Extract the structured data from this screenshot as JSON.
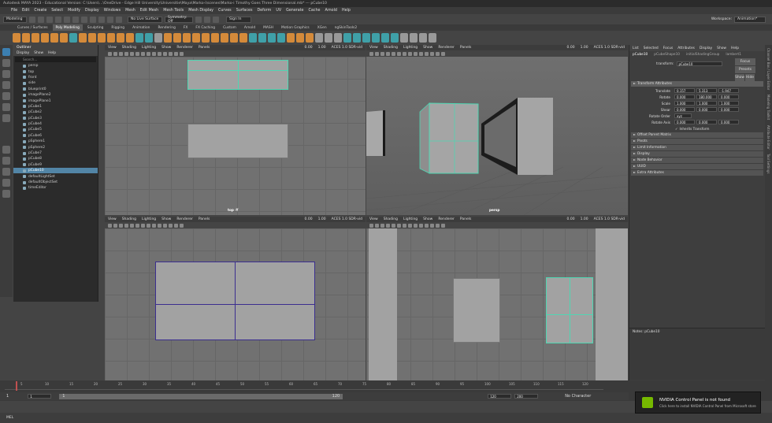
{
  "title_bar": "Autodesk MAYA 2023 - Educational Version: C:\\Users\\...\\OneDrive - Edge Hill University\\Universitie\\Maya\\Marko-i\\scenes\\Marko-i Timothy Goes Three Dimensional.mb*  ---  pCube10",
  "menus": [
    "File",
    "Edit",
    "Create",
    "Select",
    "Modify",
    "Display",
    "Windows",
    "Mesh",
    "Edit Mesh",
    "Mesh Tools",
    "Mesh Display",
    "Curves",
    "Surfaces",
    "Deform",
    "UV",
    "Generate",
    "Cache",
    "Arnold",
    "Help"
  ],
  "workspace": {
    "label": "Workspace:",
    "value": "Animation*"
  },
  "status": {
    "menuset": "Modeling",
    "live_surface": "No Live Surface",
    "symmetry": "Symmetry: Off",
    "sign_in": "Sign In"
  },
  "shelf_tabs": [
    "Curves / Surfaces",
    "Poly Modeling",
    "Sculpting",
    "Rigging",
    "Animation",
    "Rendering",
    "FX",
    "FX Caching",
    "Custom",
    "Arnold",
    "MASH",
    "Motion Graphics",
    "XGen",
    "ngSkinTools2"
  ],
  "shelf_active": "Poly Modeling",
  "outliner": {
    "title": "Outliner",
    "menu": [
      "Display",
      "Show",
      "Help"
    ],
    "search": "Search...",
    "items": [
      {
        "label": "persp"
      },
      {
        "label": "top"
      },
      {
        "label": "front"
      },
      {
        "label": "side"
      },
      {
        "label": "blueprint0"
      },
      {
        "label": "imagePlane2"
      },
      {
        "label": "imagePlane1"
      },
      {
        "label": "pCube1"
      },
      {
        "label": "pCube2"
      },
      {
        "label": "pCube3"
      },
      {
        "label": "pCube4"
      },
      {
        "label": "pCube5"
      },
      {
        "label": "pCube6"
      },
      {
        "label": "pSphere1"
      },
      {
        "label": "pSphere2"
      },
      {
        "label": "pCube7"
      },
      {
        "label": "pCube8"
      },
      {
        "label": "pCube9"
      },
      {
        "label": "pCube10",
        "selected": true
      },
      {
        "label": "defaultLightSet"
      },
      {
        "label": "defaultObjectSet"
      },
      {
        "label": "timeEditor"
      }
    ]
  },
  "viewport_menu": [
    "View",
    "Shading",
    "Lighting",
    "Show",
    "Renderer",
    "Panels"
  ],
  "viewports": {
    "top": "top -Y",
    "persp": "persp",
    "front": "front -Z",
    "side": "side -X"
  },
  "viewport_values": {
    "exposure": "0.00",
    "gamma": "1.00",
    "colorspace": "ACES 1.0 SDR-vid"
  },
  "attribute_editor": {
    "tabs": [
      "List",
      "Selected",
      "Focus",
      "Attributes",
      "Display",
      "Show",
      "Help"
    ],
    "node_tabs": [
      "pCube10",
      "pCubeShape10",
      "initialShadingGroup",
      "lambert1"
    ],
    "transform_label": "transform:",
    "transform_value": "pCube10",
    "buttons": [
      "Focus",
      "Presets",
      "Show",
      "Hide"
    ],
    "section": "Transform Attributes",
    "rows": [
      {
        "label": "Translate",
        "v": [
          "0.157",
          "5.313",
          "-1.947"
        ]
      },
      {
        "label": "Rotate",
        "v": [
          "0.000",
          "180.000",
          "0.000"
        ]
      },
      {
        "label": "Scale",
        "v": [
          "1.000",
          "1.000",
          "1.000"
        ]
      },
      {
        "label": "Shear",
        "v": [
          "0.000",
          "0.000",
          "0.000"
        ]
      }
    ],
    "rotate_order_label": "Rotate Order",
    "rotate_order": "xyz",
    "rotate_axis_label": "Rotate Axis",
    "rotate_axis": [
      "0.000",
      "0.000",
      "0.000"
    ],
    "inherits": "Inherits Transform",
    "collapsed": [
      "Offset Parent Matrix",
      "Pivots",
      "Limit Information",
      "Display",
      "Node Behavior",
      "UUID",
      "Extra Attributes"
    ],
    "notes": "Notes:  pCube10",
    "bottom_buttons": [
      "Select",
      "Load Attributes",
      "Copy Tab"
    ]
  },
  "right_strip": [
    "Channel Box / Layer Editor",
    "Modeling Toolkit",
    "Attribute Editor",
    "Tool Settings"
  ],
  "timeline": {
    "ticks": [
      "5",
      "10",
      "15",
      "20",
      "25",
      "30",
      "35",
      "40",
      "45",
      "50",
      "55",
      "60",
      "65",
      "70",
      "75",
      "80",
      "85",
      "90",
      "95",
      "100",
      "105",
      "110",
      "115",
      "120"
    ],
    "start": "1",
    "current": "1",
    "range_start": "1",
    "range_end": "120",
    "end1": "120",
    "end2": "200",
    "no_character": "No Character"
  },
  "toast": {
    "title": "NVIDIA Control Panel is not found",
    "body": "Click here to install NVIDIA Control Panel from Microsoft store"
  },
  "cmd": "MEL"
}
